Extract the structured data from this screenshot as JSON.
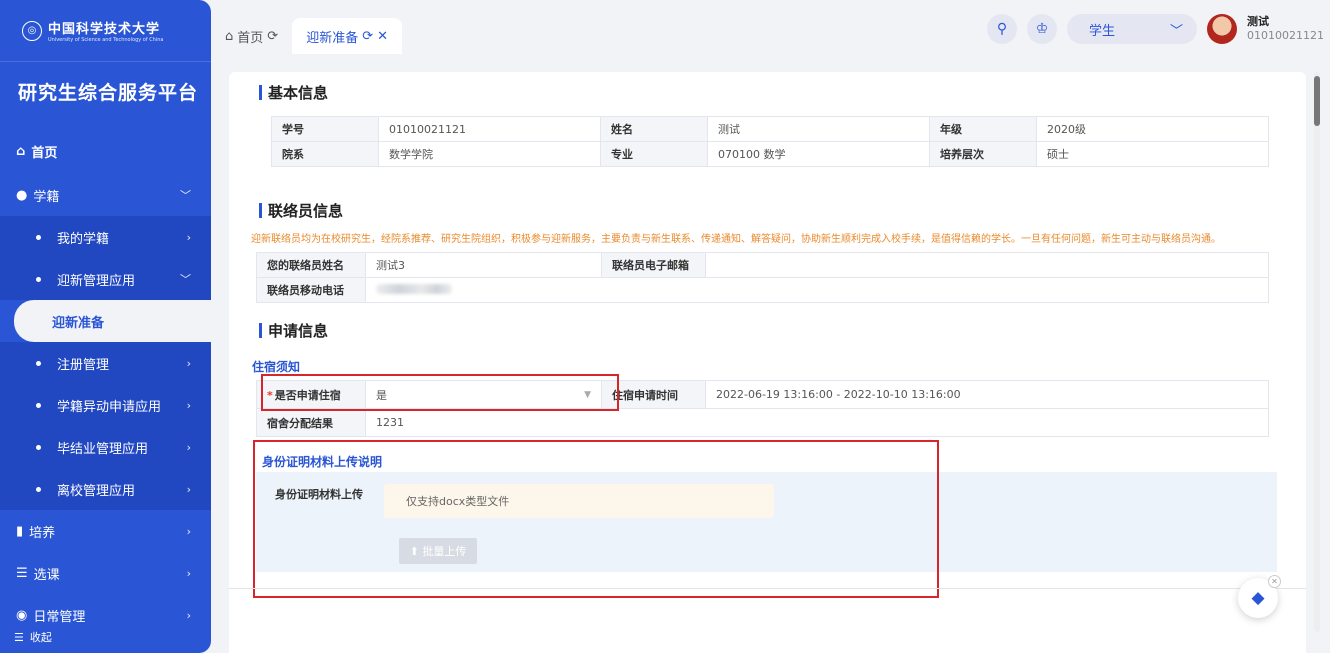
{
  "sidebar": {
    "logo_main": "中国科学技术大学",
    "logo_sub": "University of Science and Technology of China",
    "platform_title": "研究生综合服务平台",
    "home": "首页",
    "items": [
      {
        "label": "学籍"
      },
      {
        "label": "我的学籍"
      },
      {
        "label": "迎新管理应用"
      },
      {
        "label": "迎新准备"
      },
      {
        "label": "注册管理"
      },
      {
        "label": "学籍异动申请应用"
      },
      {
        "label": "毕结业管理应用"
      },
      {
        "label": "离校管理应用"
      },
      {
        "label": "培养"
      },
      {
        "label": "选课"
      },
      {
        "label": "日常管理"
      }
    ],
    "collapse": "收起"
  },
  "tabs": [
    {
      "label": "首页"
    },
    {
      "label": "迎新准备"
    }
  ],
  "topbar": {
    "role": "学生",
    "user_name": "测试",
    "user_id": "01010021121"
  },
  "basic": {
    "title": "基本信息",
    "rows": [
      [
        [
          "学号",
          "01010021121"
        ],
        [
          "姓名",
          "测试"
        ],
        [
          "年级",
          "2020级"
        ]
      ],
      [
        [
          "院系",
          "数学学院"
        ],
        [
          "专业",
          "070100 数学"
        ],
        [
          "培养层次",
          "硕士"
        ]
      ]
    ]
  },
  "liaison": {
    "title": "联络员信息",
    "notice": "迎新联络员均为在校研究生，经院系推荐、研究生院组织，积极参与迎新服务，主要负责与新生联系、传递通知、解答疑问，协助新生顺利完成入校手续，是值得信赖的学长。一旦有任何问题，新生可主动与联络员沟通。",
    "name_label": "您的联络员姓名",
    "name_value": "测试3",
    "email_label": "联络员电子邮箱",
    "email_value": "",
    "phone_label": "联络员移动电话"
  },
  "apply": {
    "title": "申请信息",
    "housing_notice": "住宿须知",
    "apply_housing_label": "是否申请住宿",
    "apply_housing_value": "是",
    "housing_time_label": "住宿申请时间",
    "housing_time_value": "2022-06-19 13:16:00 - 2022-10-10 13:16:00",
    "dorm_result_label": "宿舍分配结果",
    "dorm_result_value": "1231"
  },
  "upload": {
    "title": "身份证明材料上传说明",
    "label": "身份证明材料上传",
    "hint": "仅支持docx类型文件",
    "button": "批量上传"
  },
  "colors": {
    "primary": "#2a56d6",
    "highlight": "#d7262b",
    "notice": "#e98a2b"
  }
}
